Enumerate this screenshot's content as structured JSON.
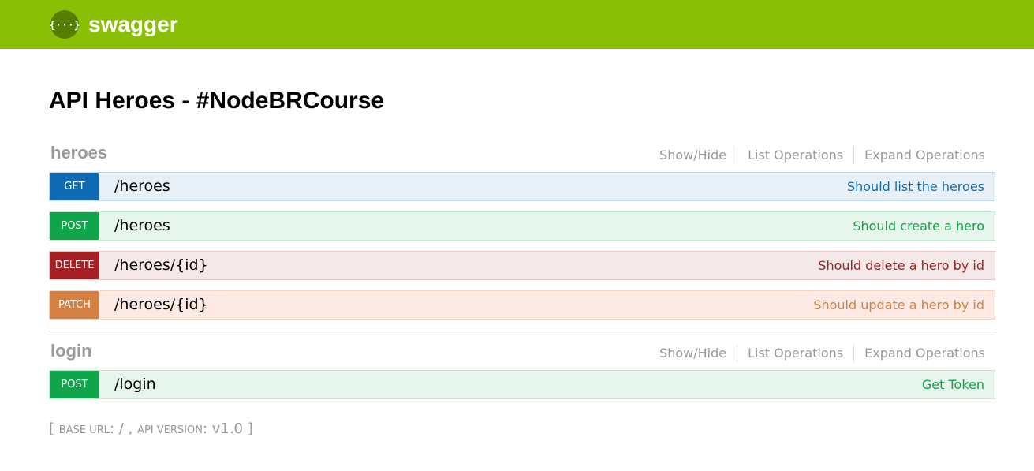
{
  "header": {
    "brand": "swagger",
    "logo_icon": "swagger-braces-icon",
    "brand_color": "#89bf04"
  },
  "info": {
    "title": "API Heroes - #NodeBRCourse"
  },
  "resources": [
    {
      "name": "heroes",
      "links": {
        "show_hide": "Show/Hide",
        "list_ops": "List Operations",
        "expand_ops": "Expand Operations"
      },
      "operations": [
        {
          "method": "GET",
          "path": "/heroes",
          "summary": "Should list the heroes"
        },
        {
          "method": "POST",
          "path": "/heroes",
          "summary": "Should create a hero"
        },
        {
          "method": "DELETE",
          "path": "/heroes/{id}",
          "summary": "Should delete a hero by id"
        },
        {
          "method": "PATCH",
          "path": "/heroes/{id}",
          "summary": "Should update a hero by id"
        }
      ]
    },
    {
      "name": "login",
      "links": {
        "show_hide": "Show/Hide",
        "list_ops": "List Operations",
        "expand_ops": "Expand Operations"
      },
      "operations": [
        {
          "method": "POST",
          "path": "/login",
          "summary": "Get Token"
        }
      ]
    }
  ],
  "footer": {
    "open_bracket": "[",
    "base_url_label": "base url",
    "base_url_value": "/",
    "separator": ",",
    "api_version_label": "api version",
    "api_version_value": "v1.0",
    "close_bracket": "]"
  },
  "method_colors": {
    "GET": "#0f6ab4",
    "POST": "#10a54a",
    "DELETE": "#a41e22",
    "PATCH": "#d38042"
  }
}
